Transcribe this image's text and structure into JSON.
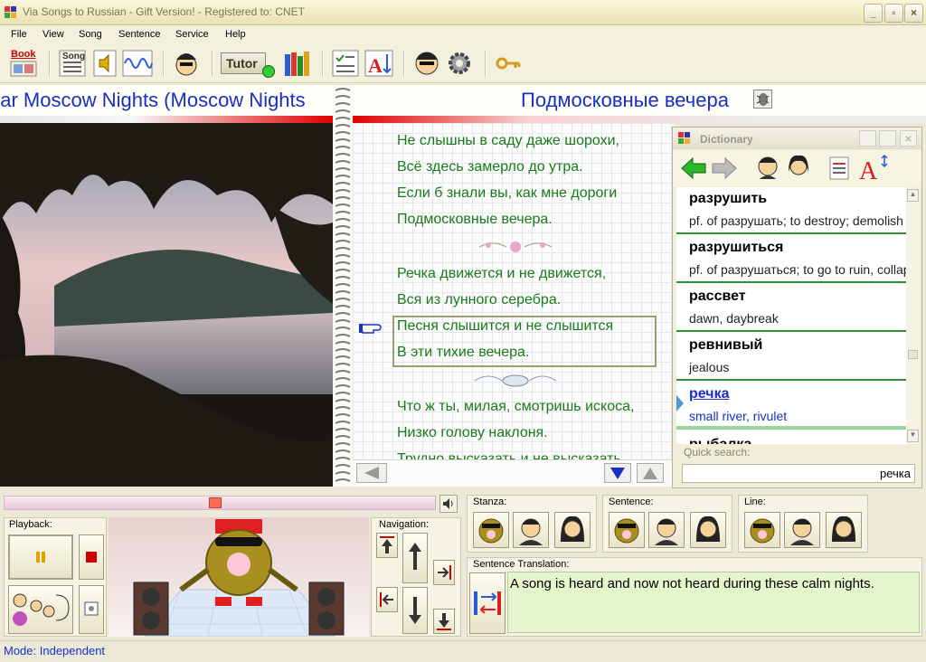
{
  "window": {
    "title": "Via Songs to Russian - Gift Version! - Registered to: CNET"
  },
  "menu": [
    "File",
    "View",
    "Song",
    "Sentence",
    "Service",
    "Help"
  ],
  "toolbar": {
    "book_label": "Book",
    "song_label": "Song",
    "tutor_label": "Tutor"
  },
  "song": {
    "title_en": "ear Moscow Nights (Moscow Nights",
    "title_ru": "Подмосковные вечера"
  },
  "lyrics": [
    "Не слышны в саду даже шорохи,",
    "Всё здесь замерло до утра.",
    "Если б знали вы, как мне дороги",
    "Подмосковные вечера.",
    "Речка движется и не движется,",
    "Вся из лунного серебра.",
    "Песня слышится и не слышится",
    "В эти тихие вечера.",
    "Что ж ты, милая, смотришь искоса,",
    "Низко голову наклоня.",
    "Трудно высказать и не высказать"
  ],
  "dictionary": {
    "title": "Dictionary",
    "entries": [
      {
        "word": "разрушить",
        "def": "pf. of разрушать; to destroy; demolish"
      },
      {
        "word": "разрушиться",
        "def": "pf. of разрушаться; to go to ruin, collapse"
      },
      {
        "word": "рассвет",
        "def": "dawn, daybreak"
      },
      {
        "word": "ревнивый",
        "def": "jealous"
      },
      {
        "word": "речка",
        "def": "small river, rivulet"
      },
      {
        "word": "рыбалка",
        "def": ""
      }
    ],
    "quick_search_label": "Quick search:",
    "quick_search_value": "речка"
  },
  "playback": {
    "progress": 0.49
  },
  "labels": {
    "playback": "Playback:",
    "navigation": "Navigation:",
    "stanza": "Stanza:",
    "sentence": "Sentence:",
    "line": "Line:",
    "sentence_translation": "Sentence Translation:"
  },
  "translation": "A song is heard and now not heard during these calm nights.",
  "status": "Mode: Independent"
}
